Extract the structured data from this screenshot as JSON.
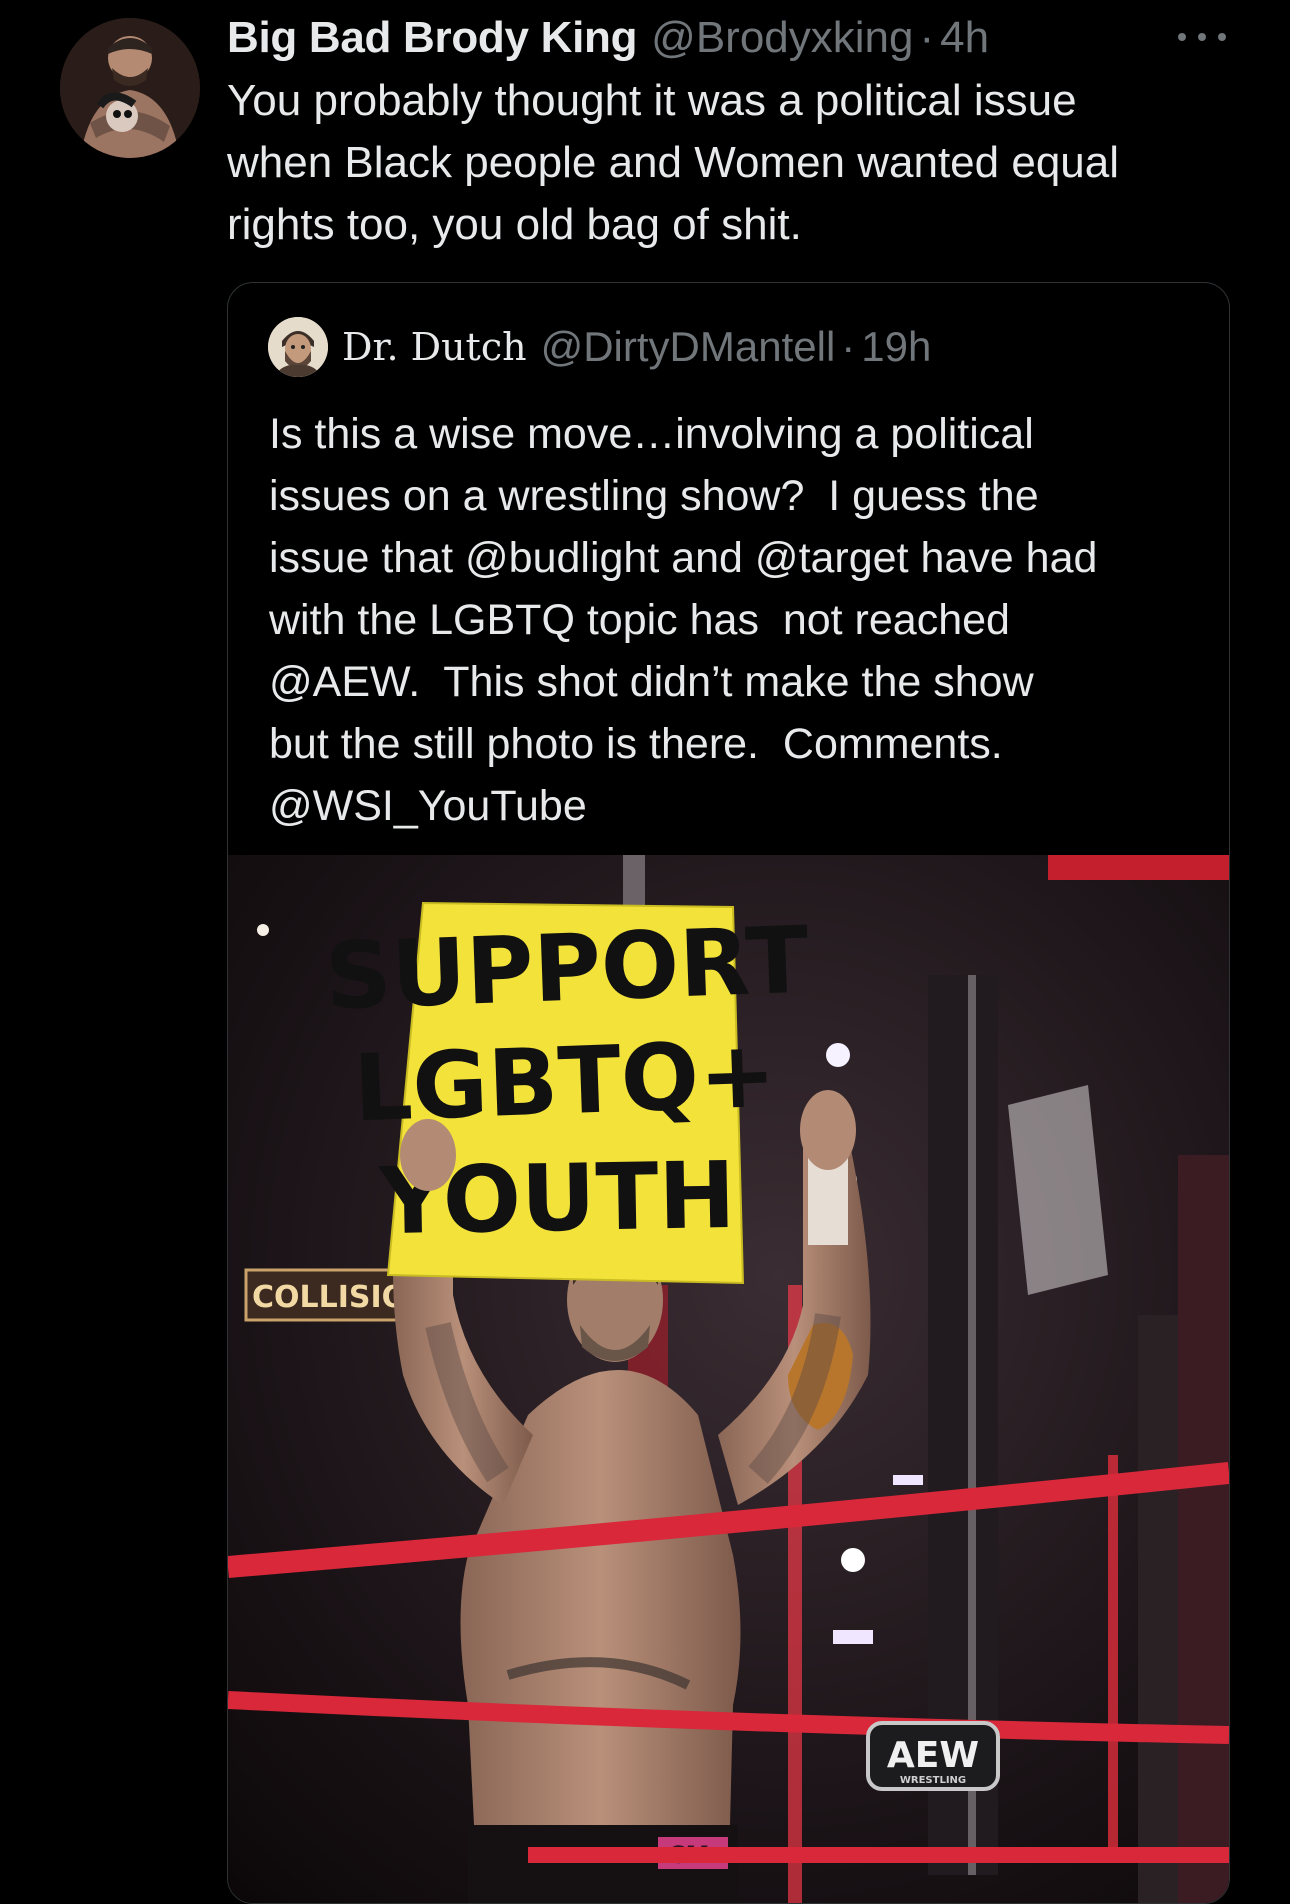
{
  "tweet": {
    "display_name": "Big Bad Brody King",
    "handle": "@Brodyxking",
    "separator": "·",
    "time": "4h",
    "text_lines": [
      "You probably thought it was a political issue",
      "when Black people and Women wanted equal",
      "rights too, you old bag of shit."
    ],
    "more_icon": "more-horizontal-icon"
  },
  "quoted_tweet": {
    "display_name": "Dr. Dutch",
    "handle": "@DirtyDMantell",
    "separator": "·",
    "time": "19h",
    "text_lines": [
      "Is this a wise move…involving a political",
      "issues on a wrestling show?  I guess the",
      "issue that @budlight and @target have had",
      "with the LGBTQ topic has  not reached",
      "@AEW.  This shot didn’t make the show",
      "but the still photo is there.  Comments.",
      "@WSI_YouTube"
    ],
    "media": {
      "sign_lines": [
        "SUPPORT",
        "LGBTQ+",
        "YOUTH"
      ],
      "collision_banner": "COLLISION",
      "aew_logo": "AEW",
      "aew_logo_sub": "WRESTLING",
      "trunks_text": "CM"
    }
  },
  "colors": {
    "background": "#000000",
    "primary_text": "#e7e9ea",
    "secondary_text": "#71767b",
    "border": "#2f3336",
    "sign_yellow": "#f2e23a",
    "ring_rope_red": "#d8283a"
  }
}
